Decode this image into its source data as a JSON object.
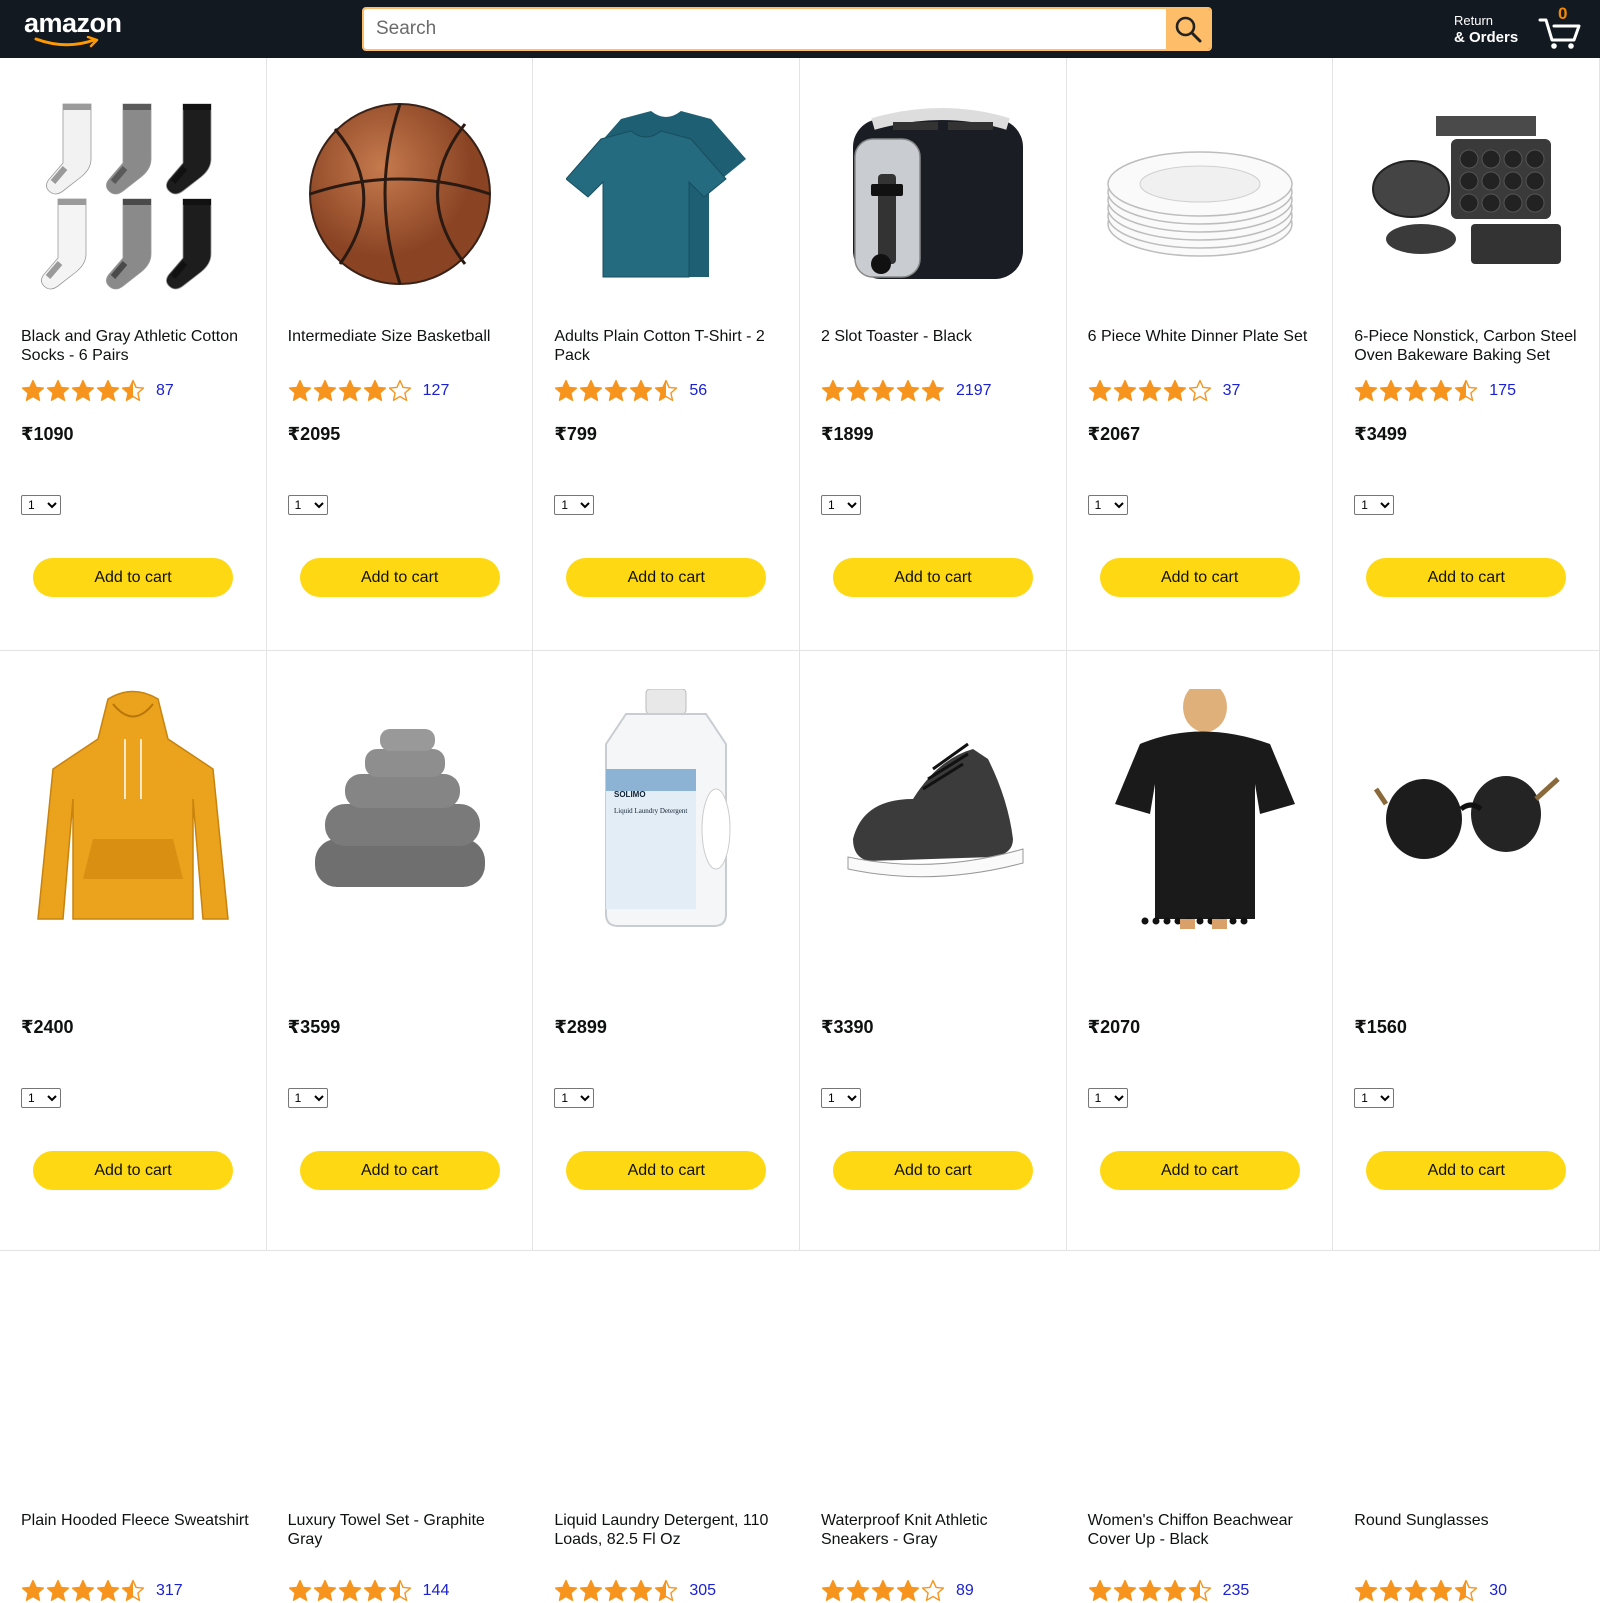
{
  "header": {
    "logo_text": "amazon",
    "search_placeholder": "Search",
    "orders_top": "Return",
    "orders_bottom": "& Orders",
    "cart_count": "0"
  },
  "products": [
    {
      "name": "Black and Gray Athletic Cotton Socks - 6 Pairs",
      "stars": 4.5,
      "rating_count": "87",
      "price": "₹1090",
      "qty": "1",
      "image": "socks"
    },
    {
      "name": "Intermediate Size Basketball",
      "stars": 4,
      "rating_count": "127",
      "price": "₹2095",
      "qty": "1",
      "image": "basketball"
    },
    {
      "name": "Adults Plain Cotton T-Shirt - 2 Pack",
      "stars": 4.5,
      "rating_count": "56",
      "price": "₹799",
      "qty": "1",
      "image": "tshirt"
    },
    {
      "name": "2 Slot Toaster - Black",
      "stars": 5,
      "rating_count": "2197",
      "price": "₹1899",
      "qty": "1",
      "image": "toaster"
    },
    {
      "name": "6 Piece White Dinner Plate Set",
      "stars": 4,
      "rating_count": "37",
      "price": "₹2067",
      "qty": "1",
      "image": "plates"
    },
    {
      "name": "6-Piece Nonstick, Carbon Steel Oven Bakeware Baking Set",
      "stars": 4.5,
      "rating_count": "175",
      "price": "₹3499",
      "qty": "1",
      "image": "bakeware"
    },
    {
      "name": "Plain Hooded Fleece Sweatshirt",
      "stars": 4.5,
      "rating_count": "317",
      "price": "₹2400",
      "qty": "1",
      "image": "hoodie"
    },
    {
      "name": "Luxury Towel Set - Graphite Gray",
      "stars": 4.5,
      "rating_count": "144",
      "price": "₹3599",
      "qty": "1",
      "image": "towels"
    },
    {
      "name": "Liquid Laundry Detergent, 110 Loads, 82.5 Fl Oz",
      "stars": 4.5,
      "rating_count": "305",
      "price": "₹2899",
      "qty": "1",
      "image": "detergent"
    },
    {
      "name": "Waterproof Knit Athletic Sneakers - Gray",
      "stars": 4,
      "rating_count": "89",
      "price": "₹3390",
      "qty": "1",
      "image": "sneakers"
    },
    {
      "name": "Women's Chiffon Beachwear Cover Up - Black",
      "stars": 4.5,
      "rating_count": "235",
      "price": "₹2070",
      "qty": "1",
      "image": "coverup"
    },
    {
      "name": "Round Sunglasses",
      "stars": 4.5,
      "rating_count": "30",
      "price": "₹1560",
      "qty": "1",
      "image": "sunglasses"
    }
  ],
  "labels": {
    "add_to_cart": "Add to cart",
    "detergent_brand": "SOLIMO",
    "detergent_label": "Liquid Laundry Detergent"
  },
  "colors": {
    "header_bg": "#131921",
    "search_button": "#febd69",
    "star": "#f7941d",
    "add_button": "#ffd814",
    "link": "#1a21d4"
  }
}
